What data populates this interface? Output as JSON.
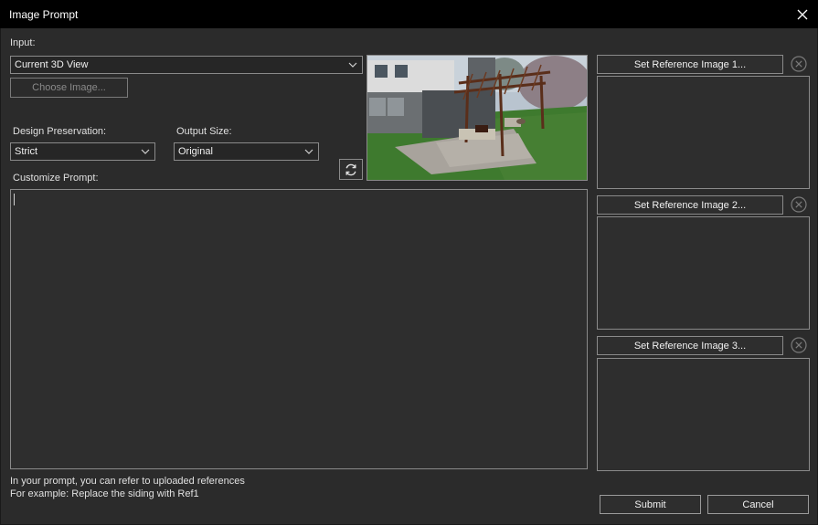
{
  "window": {
    "title": "Image Prompt"
  },
  "input": {
    "label": "Input:",
    "selected": "Current 3D View",
    "choose_button": "Choose Image..."
  },
  "design_preservation": {
    "label": "Design Preservation:",
    "selected": "Strict"
  },
  "output_size": {
    "label": "Output Size:",
    "selected": "Original"
  },
  "prompt": {
    "label": "Customize Prompt:",
    "value": ""
  },
  "hint": {
    "line1": "In your prompt, you can refer to uploaded references",
    "line2": "For example: Replace the siding with Ref1"
  },
  "references": [
    {
      "button": "Set Reference Image 1..."
    },
    {
      "button": "Set Reference Image 2..."
    },
    {
      "button": "Set Reference Image 3..."
    }
  ],
  "actions": {
    "submit": "Submit",
    "cancel": "Cancel"
  },
  "colors": {
    "titlebar": "#000000",
    "background": "#2b2b2b",
    "border": "#8a8a8a",
    "text": "#e6e6e6"
  },
  "icons": {
    "close": "close-icon",
    "refresh": "refresh-icon",
    "clear": "clear-circle-icon",
    "dropdown": "chevron-down-icon"
  }
}
